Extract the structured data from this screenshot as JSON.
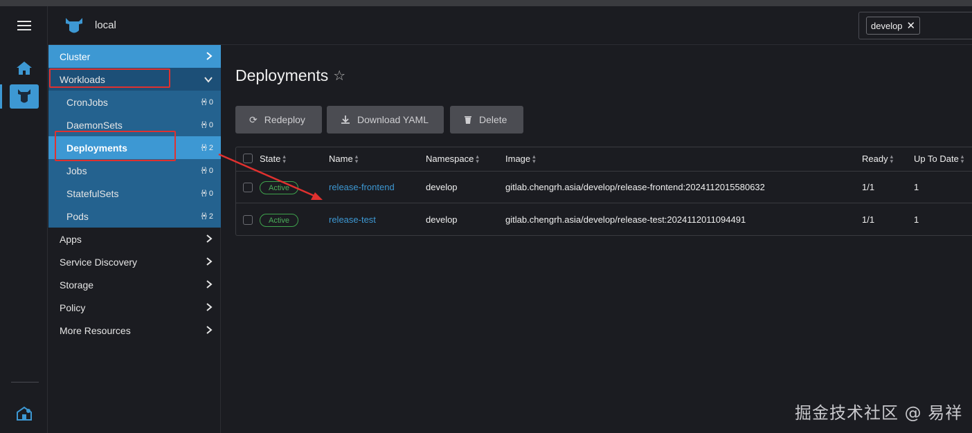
{
  "header": {
    "cluster_name": "local"
  },
  "namespace_filter": {
    "chip": "develop"
  },
  "nav": {
    "cluster": "Cluster",
    "workloads": "Workloads",
    "sub_items": [
      {
        "label": "CronJobs",
        "count": "0"
      },
      {
        "label": "DaemonSets",
        "count": "0"
      },
      {
        "label": "Deployments",
        "count": "2"
      },
      {
        "label": "Jobs",
        "count": "0"
      },
      {
        "label": "StatefulSets",
        "count": "0"
      },
      {
        "label": "Pods",
        "count": "2"
      }
    ],
    "groups": [
      "Apps",
      "Service Discovery",
      "Storage",
      "Policy",
      "More Resources"
    ]
  },
  "page": {
    "title": "Deployments"
  },
  "actions": {
    "redeploy": "Redeploy",
    "download": "Download YAML",
    "delete": "Delete"
  },
  "table": {
    "columns": [
      "State",
      "Name",
      "Namespace",
      "Image",
      "Ready",
      "Up To Date"
    ],
    "rows": [
      {
        "state": "Active",
        "name": "release-frontend",
        "namespace": "develop",
        "image": "gitlab.chengrh.asia/develop/release-frontend:2024112015580632",
        "ready": "1/1",
        "up_to_date": "1"
      },
      {
        "state": "Active",
        "name": "release-test",
        "namespace": "develop",
        "image": "gitlab.chengrh.asia/develop/release-test:2024112011094491",
        "ready": "1/1",
        "up_to_date": "1"
      }
    ]
  },
  "watermark": "掘金技术社区 @ 易祥",
  "colors": {
    "accent": "#3d98d3",
    "workloads_bg": "#1c4f77",
    "sub_bg": "#24628f",
    "annotation": "#e0312f",
    "active_badge": "#4cae5a"
  },
  "icons": [
    "hamburger-icon",
    "home-icon",
    "cluster-icon",
    "extensions-icon",
    "star-icon",
    "refresh-icon",
    "download-icon",
    "trash-icon",
    "chevron-right-icon",
    "chevron-down-icon",
    "close-icon"
  ]
}
